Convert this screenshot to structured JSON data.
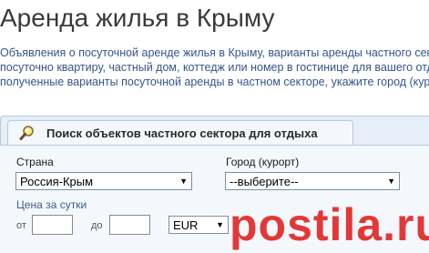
{
  "page": {
    "title": "Аренда жилья в Крыму",
    "description_lines": [
      "Объявления о посуточной аренде жилья в Крыму, варианты аренды частного секто",
      "посуточно квартиру, частный дом, коттедж или номер в гостинице для вашего отдых",
      "полученные варианты посуточной аренды в частном секторе, укажите город (курор"
    ]
  },
  "search_panel": {
    "tab_label": "Поиск объектов частного сектора для отдыха",
    "tab_icon": "magnifier-icon",
    "country_label": "Страна",
    "country_value": "Россия-Крым",
    "city_label": "Город (курорт)",
    "city_value": "--выберите--",
    "price_label": "Цена за сутки",
    "from_label": "от",
    "from_value": "",
    "to_label": "до",
    "to_value": "",
    "currency_value": "EUR"
  },
  "watermark": {
    "text": "postila.ru"
  },
  "colors": {
    "title_text": "#3a3a3a",
    "description_text": "#35558a",
    "panel_border": "#b5c9e0",
    "panel_bg": "#f4f8fc",
    "watermark": "#e01e1e"
  }
}
